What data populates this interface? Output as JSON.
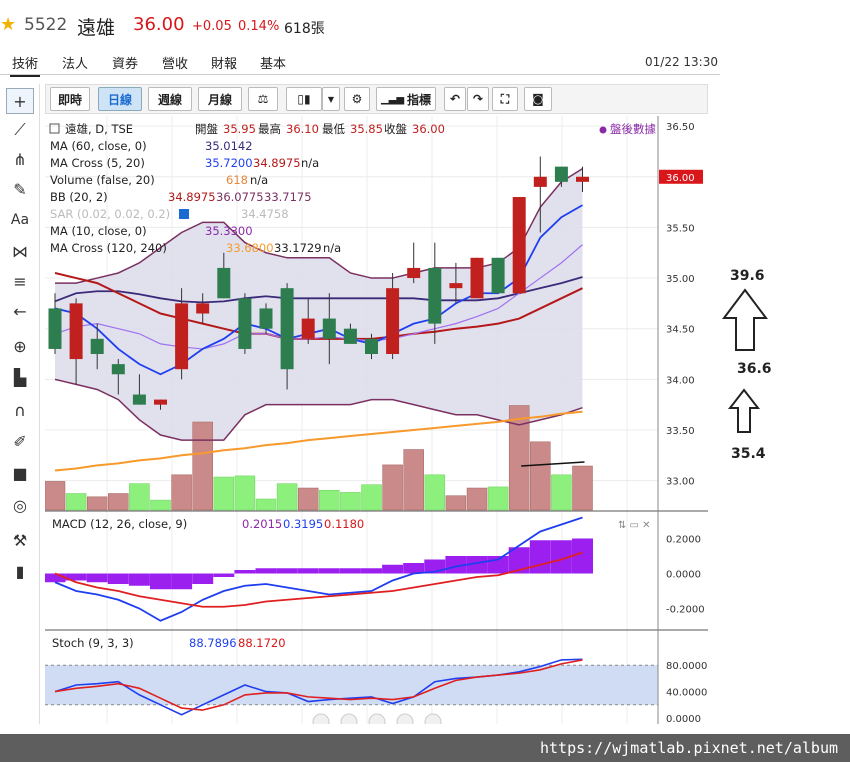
{
  "header": {
    "code": "5522",
    "name": "遠雄",
    "price": "36.00",
    "change": "+0.05",
    "change_pct": "0.14%",
    "volume": "618張"
  },
  "tabs": [
    "技術",
    "法人",
    "資券",
    "營收",
    "財報",
    "基本"
  ],
  "datetime": "01/22 13:30",
  "toolbar": {
    "intraday": "即時",
    "daily": "日線",
    "weekly": "週線",
    "monthly": "月線",
    "indicators": "指標"
  },
  "legend": {
    "main": {
      "title": "遠雄, D, TSE",
      "open_label": "開盤",
      "open": "35.95",
      "high_label": "最高",
      "high": "36.10",
      "low_label": "最低",
      "low": "35.85",
      "close_label": "收盤",
      "close": "36.00"
    },
    "after_hours": "盤後數據",
    "ma60": {
      "label": "MA (60, close, 0)",
      "value": "35.0142"
    },
    "macross1": {
      "label": "MA Cross (5, 20)",
      "v1": "35.7200",
      "v2": "34.8975",
      "v3": "n/a"
    },
    "volume": {
      "label": "Volume (false, 20)",
      "v1": "618",
      "v2": "n/a"
    },
    "bb": {
      "label": "BB (20, 2)",
      "v1": "34.8975",
      "v2": "36.0775",
      "v3": "33.7175"
    },
    "sar": {
      "label": "SAR (0.02, 0.02, 0.2)",
      "v1": "34.4758"
    },
    "ma10": {
      "label": "MA (10, close, 0)",
      "value": "35.3300"
    },
    "macross2": {
      "label": "MA Cross (120, 240)",
      "v1": "33.6800",
      "v2": "33.1729",
      "v3": "n/a"
    }
  },
  "macd_legend": {
    "label": "MACD (12, 26, close, 9)",
    "v1": "0.2015",
    "v2": "0.3195",
    "v3": "0.1180"
  },
  "stoch_legend": {
    "label": "Stoch (9, 3, 3)",
    "v1": "88.7896",
    "v2": "88.1720"
  },
  "price_axis": [
    "36.50",
    "36.00",
    "35.50",
    "35.00",
    "34.50",
    "34.00",
    "33.50",
    "33.00"
  ],
  "current_price_tag": "36.00",
  "macd_axis": [
    "0.2000",
    "0.0000",
    "-0.2000"
  ],
  "stoch_axis": [
    "80.0000",
    "40.0000",
    "0.0000"
  ],
  "annotations": {
    "top": "39.6",
    "mid": "36.6",
    "bottom": "35.4"
  },
  "watermark": "https://wjmatlab.pixnet.net/album",
  "colors": {
    "up": "#c0211e",
    "down": "#2e7d4f",
    "vol_up": "#c98a89",
    "vol_down": "#8df07c",
    "bb_fill": "#dcdceb",
    "bb_line": "#7a3060",
    "ma_blue": "#1f3ef0",
    "ma_purple": "#3b2a7a",
    "ma_red": "#b41818",
    "ma_orange": "#f79a2b",
    "ma_violet": "#a070f0",
    "macd_hist": "#9b20f0"
  },
  "chart_data": {
    "type": "candlestick",
    "candles": [
      {
        "o": 34.7,
        "h": 34.85,
        "l": 34.25,
        "c": 34.3
      },
      {
        "o": 34.2,
        "h": 34.8,
        "l": 33.95,
        "c": 34.75
      },
      {
        "o": 34.4,
        "h": 34.55,
        "l": 34.1,
        "c": 34.25
      },
      {
        "o": 34.15,
        "h": 34.2,
        "l": 33.85,
        "c": 34.05
      },
      {
        "o": 33.85,
        "h": 34.05,
        "l": 33.75,
        "c": 33.75
      },
      {
        "o": 33.75,
        "h": 33.8,
        "l": 33.7,
        "c": 33.8
      },
      {
        "o": 34.1,
        "h": 34.9,
        "l": 34.0,
        "c": 34.75
      },
      {
        "o": 34.65,
        "h": 34.85,
        "l": 34.55,
        "c": 34.75
      },
      {
        "o": 35.1,
        "h": 35.25,
        "l": 34.8,
        "c": 34.8
      },
      {
        "o": 34.8,
        "h": 34.85,
        "l": 34.25,
        "c": 34.3
      },
      {
        "o": 34.7,
        "h": 34.75,
        "l": 34.45,
        "c": 34.5
      },
      {
        "o": 34.9,
        "h": 34.95,
        "l": 33.9,
        "c": 34.1
      },
      {
        "o": 34.4,
        "h": 34.8,
        "l": 34.35,
        "c": 34.6
      },
      {
        "o": 34.6,
        "h": 34.85,
        "l": 34.15,
        "c": 34.4
      },
      {
        "o": 34.5,
        "h": 34.55,
        "l": 34.35,
        "c": 34.35
      },
      {
        "o": 34.4,
        "h": 34.45,
        "l": 34.2,
        "c": 34.25
      },
      {
        "o": 34.25,
        "h": 35.05,
        "l": 34.2,
        "c": 34.9
      },
      {
        "o": 35.0,
        "h": 35.35,
        "l": 34.95,
        "c": 35.1
      },
      {
        "o": 35.1,
        "h": 35.35,
        "l": 34.35,
        "c": 34.55
      },
      {
        "o": 34.9,
        "h": 35.15,
        "l": 34.75,
        "c": 34.95
      },
      {
        "o": 34.8,
        "h": 35.2,
        "l": 34.8,
        "c": 35.2
      },
      {
        "o": 35.2,
        "h": 35.2,
        "l": 34.85,
        "c": 34.85
      },
      {
        "o": 34.85,
        "h": 35.8,
        "l": 34.85,
        "c": 35.8
      },
      {
        "o": 35.9,
        "h": 36.2,
        "l": 35.45,
        "c": 36.0
      },
      {
        "o": 36.1,
        "h": 36.1,
        "l": 35.9,
        "c": 35.95
      },
      {
        "o": 35.95,
        "h": 36.1,
        "l": 35.85,
        "c": 36.0
      }
    ],
    "volume": [
      {
        "v": 2.6,
        "up": true
      },
      {
        "v": 1.5,
        "up": false
      },
      {
        "v": 1.2,
        "up": true
      },
      {
        "v": 1.5,
        "up": true
      },
      {
        "v": 2.4,
        "up": false
      },
      {
        "v": 0.9,
        "up": false
      },
      {
        "v": 3.2,
        "up": true
      },
      {
        "v": 8.0,
        "up": true
      },
      {
        "v": 3.0,
        "up": false
      },
      {
        "v": 3.1,
        "up": false
      },
      {
        "v": 1.0,
        "up": false
      },
      {
        "v": 2.4,
        "up": false
      },
      {
        "v": 2.0,
        "up": true
      },
      {
        "v": 1.8,
        "up": false
      },
      {
        "v": 1.6,
        "up": false
      },
      {
        "v": 2.3,
        "up": false
      },
      {
        "v": 4.1,
        "up": true
      },
      {
        "v": 5.5,
        "up": true
      },
      {
        "v": 3.2,
        "up": false
      },
      {
        "v": 1.3,
        "up": true
      },
      {
        "v": 2.0,
        "up": true
      },
      {
        "v": 2.1,
        "up": false
      },
      {
        "v": 9.5,
        "up": true
      },
      {
        "v": 6.2,
        "up": true
      },
      {
        "v": 3.2,
        "up": false
      },
      {
        "v": 4.0,
        "up": true
      }
    ],
    "bb_upper": [
      34.95,
      34.95,
      35.0,
      35.05,
      35.15,
      35.3,
      35.45,
      35.55,
      35.55,
      35.35,
      35.25,
      35.2,
      35.2,
      35.2,
      35.05,
      35.0,
      35.0,
      35.05,
      35.1,
      35.1,
      35.1,
      35.15,
      35.3,
      35.7,
      35.95,
      36.08
    ],
    "bb_lower": [
      34.0,
      33.95,
      33.9,
      33.8,
      33.6,
      33.45,
      33.4,
      33.4,
      33.4,
      33.65,
      33.75,
      33.75,
      33.75,
      33.75,
      33.75,
      33.8,
      33.8,
      33.75,
      33.7,
      33.65,
      33.65,
      33.6,
      33.55,
      33.6,
      33.65,
      33.72
    ],
    "ma60": [
      34.77,
      34.85,
      34.87,
      34.87,
      34.84,
      34.8,
      34.77,
      34.76,
      34.77,
      34.8,
      34.82,
      34.8,
      34.8,
      34.8,
      34.8,
      34.8,
      34.8,
      34.8,
      34.78,
      34.78,
      34.78,
      34.8,
      34.85,
      34.9,
      34.95,
      35.01
    ],
    "ma_red": [
      35.05,
      35.0,
      34.95,
      34.85,
      34.75,
      34.65,
      34.6,
      34.55,
      34.5,
      34.45,
      34.45,
      34.4,
      34.4,
      34.4,
      34.4,
      34.4,
      34.42,
      34.45,
      34.47,
      34.5,
      34.52,
      34.55,
      34.6,
      34.7,
      34.8,
      34.9
    ],
    "ma_blue": [
      34.7,
      34.65,
      34.5,
      34.3,
      34.15,
      34.05,
      34.15,
      34.3,
      34.4,
      34.55,
      34.5,
      34.4,
      34.45,
      34.5,
      34.4,
      34.35,
      34.45,
      34.55,
      34.6,
      34.75,
      34.85,
      34.85,
      35.0,
      35.4,
      35.6,
      35.72
    ],
    "ma_violet": [
      34.45,
      34.52,
      34.55,
      34.5,
      34.45,
      34.35,
      34.32,
      34.3,
      34.35,
      34.45,
      34.45,
      34.4,
      34.4,
      34.42,
      34.4,
      34.38,
      34.4,
      34.45,
      34.5,
      34.55,
      34.62,
      34.7,
      34.85,
      35.0,
      35.15,
      35.33
    ],
    "ma_orange": [
      33.1,
      33.12,
      33.15,
      33.17,
      33.2,
      33.22,
      33.25,
      33.27,
      33.3,
      33.32,
      33.35,
      33.37,
      33.4,
      33.42,
      33.44,
      33.46,
      33.48,
      33.5,
      33.52,
      33.54,
      33.56,
      33.58,
      33.61,
      33.63,
      33.66,
      33.68
    ],
    "macd_hist": [
      -0.05,
      -0.04,
      -0.05,
      -0.06,
      -0.07,
      -0.09,
      -0.09,
      -0.06,
      -0.02,
      0.02,
      0.03,
      0.03,
      0.03,
      0.03,
      0.03,
      0.03,
      0.05,
      0.06,
      0.08,
      0.1,
      0.1,
      0.1,
      0.15,
      0.19,
      0.19,
      0.2
    ],
    "macd_line": [
      -0.05,
      -0.1,
      -0.12,
      -0.15,
      -0.2,
      -0.27,
      -0.22,
      -0.15,
      -0.1,
      -0.07,
      -0.06,
      -0.08,
      -0.1,
      -0.12,
      -0.11,
      -0.1,
      -0.04,
      0.0,
      0.01,
      0.04,
      0.06,
      0.08,
      0.16,
      0.24,
      0.28,
      0.32
    ],
    "macd_signal": [
      0.0,
      -0.05,
      -0.08,
      -0.1,
      -0.13,
      -0.15,
      -0.17,
      -0.19,
      -0.19,
      -0.18,
      -0.16,
      -0.15,
      -0.14,
      -0.13,
      -0.12,
      -0.11,
      -0.1,
      -0.08,
      -0.06,
      -0.04,
      -0.02,
      -0.01,
      0.02,
      0.05,
      0.08,
      0.12
    ],
    "stoch_k": [
      40,
      50,
      52,
      55,
      35,
      20,
      5,
      20,
      35,
      50,
      40,
      38,
      25,
      28,
      30,
      32,
      22,
      32,
      55,
      60,
      62,
      65,
      70,
      78,
      88,
      89
    ],
    "stoch_d": [
      40,
      45,
      48,
      52,
      45,
      30,
      15,
      12,
      20,
      35,
      38,
      38,
      32,
      30,
      28,
      30,
      28,
      32,
      45,
      57,
      62,
      65,
      68,
      73,
      82,
      88
    ],
    "ylim_price": [
      32.7,
      36.6
    ],
    "ylim_macd": [
      -0.3,
      0.3
    ],
    "ylim_stoch": [
      0,
      100
    ]
  }
}
